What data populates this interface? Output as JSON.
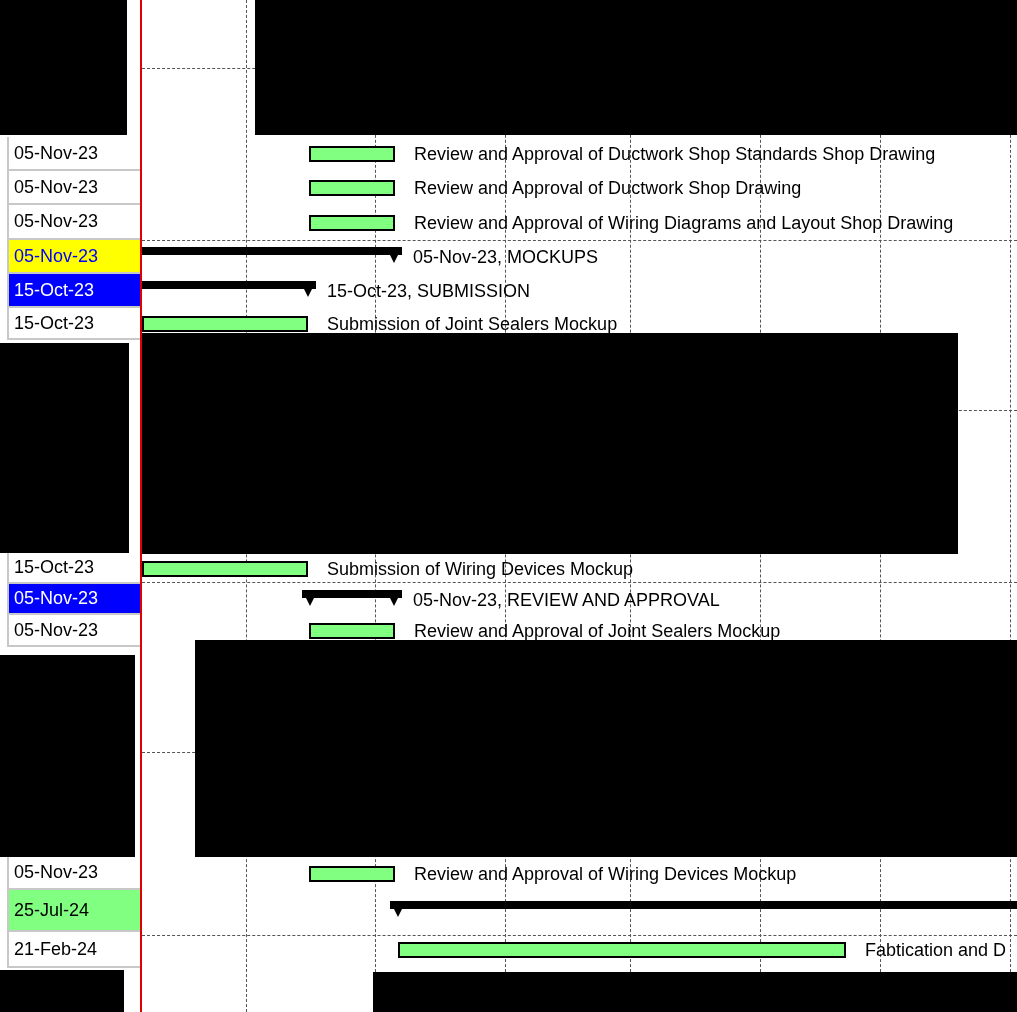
{
  "rows": [
    {
      "finish": "05-Nov-23",
      "kind": "task",
      "bar": {
        "kind": "task",
        "label": "Review and Approval of Ductwork Shop Standards Shop Drawing"
      }
    },
    {
      "finish": "05-Nov-23",
      "kind": "task",
      "bar": {
        "kind": "task",
        "label": "Review and Approval of Ductwork Shop Drawing"
      }
    },
    {
      "finish": "05-Nov-23",
      "kind": "task",
      "bar": {
        "kind": "task",
        "label": "Review and Approval of Wiring Diagrams and Layout Shop Drawing"
      }
    },
    {
      "finish": "05-Nov-23",
      "kind": "section",
      "bar": {
        "kind": "summary",
        "label": "05-Nov-23, MOCKUPS"
      }
    },
    {
      "finish": "15-Oct-23",
      "kind": "group",
      "bar": {
        "kind": "summary",
        "label": "15-Oct-23, SUBMISSION"
      }
    },
    {
      "finish": "15-Oct-23",
      "kind": "task",
      "bar": {
        "kind": "task",
        "label": "Submission of Joint Sealers Mockup"
      }
    },
    {
      "finish": "15-Oct-23",
      "kind": "task",
      "bar": {
        "kind": "task",
        "label": "Submission of Wiring Devices Mockup"
      }
    },
    {
      "finish": "05-Nov-23",
      "kind": "group",
      "bar": {
        "kind": "summary",
        "label": "05-Nov-23, REVIEW AND APPROVAL"
      }
    },
    {
      "finish": "05-Nov-23",
      "kind": "task",
      "bar": {
        "kind": "task",
        "label": "Review and Approval of Joint Sealers Mockup"
      }
    },
    {
      "finish": "05-Nov-23",
      "kind": "task",
      "bar": {
        "kind": "task",
        "label": "Review and Approval of Wiring Devices Mockup"
      }
    },
    {
      "finish": "25-Jul-24",
      "kind": "phase",
      "bar": {
        "kind": "summary"
      }
    },
    {
      "finish": "21-Feb-24",
      "kind": "task",
      "bar": {
        "kind": "task",
        "label": "Fabtication and D"
      }
    }
  ]
}
